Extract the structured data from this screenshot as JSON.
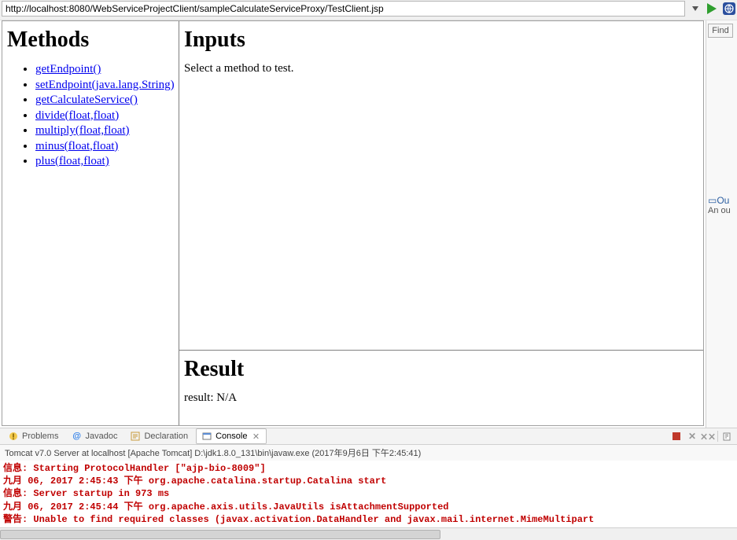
{
  "urlbar": {
    "url": "http://localhost:8080/WebServiceProjectClient/sampleCalculateServiceProxy/TestClient.jsp"
  },
  "side": {
    "find_label": "Find",
    "outline_icon": "Ou",
    "outline_text": "An ou"
  },
  "page": {
    "methods_heading": "Methods",
    "inputs_heading": "Inputs",
    "inputs_text": "Select a method to test.",
    "result_heading": "Result",
    "result_text": "result: N/A",
    "methods": [
      "getEndpoint()",
      "setEndpoint(java.lang.String)",
      "getCalculateService()",
      "divide(float,float)",
      "multiply(float,float)",
      "minus(float,float)",
      "plus(float,float)"
    ]
  },
  "tabs": {
    "problems": "Problems",
    "javadoc": "Javadoc",
    "declaration": "Declaration",
    "console": "Console"
  },
  "console": {
    "title": "Tomcat v7.0 Server at localhost [Apache Tomcat] D:\\jdk1.8.0_131\\bin\\javaw.exe (2017年9月6日 下午2:45:41)",
    "lines": [
      "信息: Starting ProtocolHandler [\"ajp-bio-8009\"]",
      "九月 06, 2017 2:45:43 下午 org.apache.catalina.startup.Catalina start",
      "信息: Server startup in 973 ms",
      "九月 06, 2017 2:45:44 下午 org.apache.axis.utils.JavaUtils isAttachmentSupported",
      "警告: Unable to find required classes (javax.activation.DataHandler and javax.mail.internet.MimeMultipart"
    ]
  }
}
